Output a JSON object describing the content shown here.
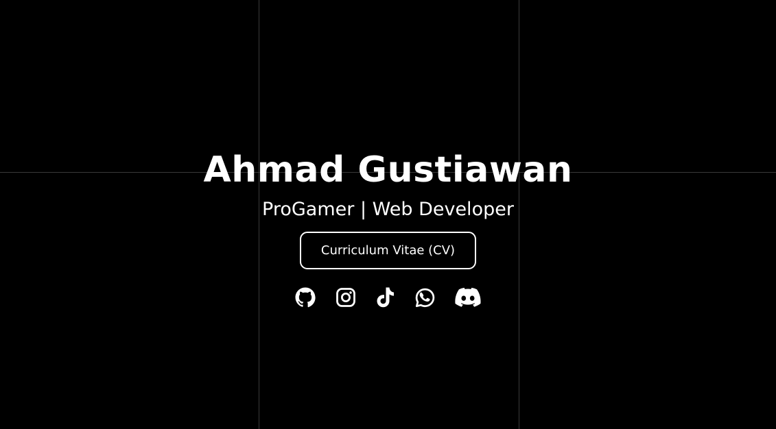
{
  "profile": {
    "name": "Ahmad Gustiawan",
    "tagline": "ProGamer | Web Developer",
    "cv_button_label": "Curriculum Vitae (CV)"
  },
  "social_links": [
    {
      "icon": "github-icon"
    },
    {
      "icon": "instagram-icon"
    },
    {
      "icon": "tiktok-icon"
    },
    {
      "icon": "whatsapp-icon"
    },
    {
      "icon": "discord-icon"
    }
  ],
  "colors": {
    "background": "#000000",
    "foreground": "#ffffff",
    "grid_line": "#3a3a3a"
  }
}
